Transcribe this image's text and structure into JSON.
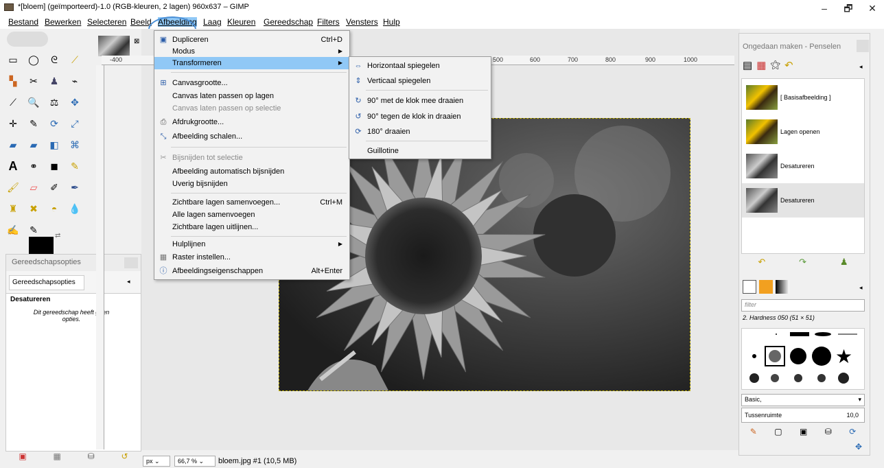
{
  "window": {
    "title": "*[bloem] (geïmporteerd)-1.0 (RGB-kleuren, 2 lagen) 960x637 – GIMP",
    "minimize": "–",
    "maximize": "🗗",
    "close": "✕"
  },
  "menubar": [
    {
      "label": "Bestand"
    },
    {
      "label": "Bewerken"
    },
    {
      "label": "Selecteren"
    },
    {
      "label": "Beeld"
    },
    {
      "label": "Afbeelding"
    },
    {
      "label": "Laag"
    },
    {
      "label": "Kleuren"
    },
    {
      "label": "Gereedschap"
    },
    {
      "label": "Filters"
    },
    {
      "label": "Vensters"
    },
    {
      "label": "Hulp"
    }
  ],
  "afbeelding_menu": {
    "items": [
      {
        "label": "Dupliceren",
        "shortcut": "Ctrl+D"
      },
      {
        "label": "Modus"
      },
      {
        "label": "Transformeren"
      },
      {
        "label": "Canvasgrootte..."
      },
      {
        "label": "Canvas laten passen op lagen"
      },
      {
        "label": "Canvas laten passen op selectie"
      },
      {
        "label": "Afdrukgrootte..."
      },
      {
        "label": "Afbeelding schalen..."
      },
      {
        "label": "Bijsnijden tot selectie"
      },
      {
        "label": "Afbeelding automatisch bijsnijden"
      },
      {
        "label": "Uverig bijsnijden"
      },
      {
        "label": "Zichtbare lagen samenvoegen...",
        "shortcut": "Ctrl+M"
      },
      {
        "label": "Alle lagen samenvoegen"
      },
      {
        "label": "Zichtbare lagen uitlijnen..."
      },
      {
        "label": "Hulplijnen"
      },
      {
        "label": "Raster instellen..."
      },
      {
        "label": "Afbeeldingseigenschappen",
        "shortcut": "Alt+Enter"
      }
    ]
  },
  "transform_submenu": {
    "items": [
      {
        "label": "Horizontaal spiegelen"
      },
      {
        "label": "Verticaal spiegelen"
      },
      {
        "label": "90° met de klok mee draaien"
      },
      {
        "label": "90° tegen de klok in draaien"
      },
      {
        "label": "180° draaien"
      },
      {
        "label": "Guillotine"
      }
    ]
  },
  "ruler_ticks": [
    "-400",
    "500",
    "600",
    "700",
    "800",
    "900",
    "1000"
  ],
  "tool_options": {
    "title": "Gereedschapsopties",
    "tab": "Gereedschapsopties",
    "tool_name": "Desatureren",
    "message": "Dit gereedschap heeft geen opties."
  },
  "undo_panel": {
    "title": "Ongedaan maken - Penselen",
    "history": [
      {
        "label": "[ Basisafbeelding ]"
      },
      {
        "label": "Lagen openen"
      },
      {
        "label": "Desatureren"
      },
      {
        "label": "Desatureren"
      }
    ]
  },
  "brushes": {
    "filter_placeholder": "filter",
    "current": "2. Hardness 050 (51 × 51)",
    "preset": "Basic,",
    "spacing_label": "Tussenruimte",
    "spacing_value": "10,0"
  },
  "status": {
    "unit": "px",
    "zoom": "66,7 %",
    "file": "bloem.jpg #1 (10,5 MB)"
  }
}
